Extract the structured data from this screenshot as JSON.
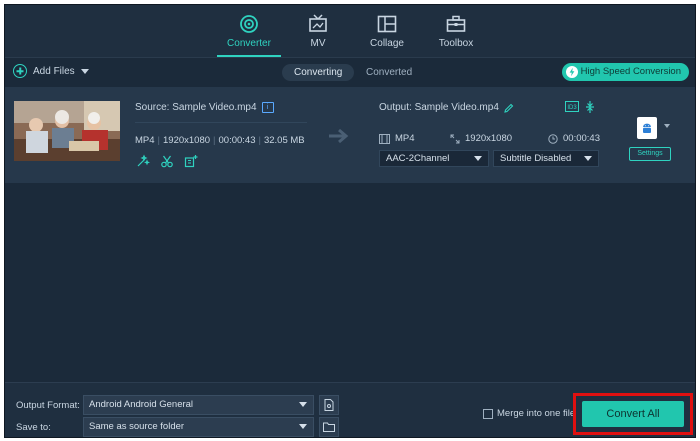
{
  "nav": {
    "tabs": [
      {
        "label": "Converter",
        "icon": "converter-icon",
        "active": true
      },
      {
        "label": "MV",
        "icon": "tv-icon",
        "active": false
      },
      {
        "label": "Collage",
        "icon": "collage-icon",
        "active": false
      },
      {
        "label": "Toolbox",
        "icon": "toolbox-icon",
        "active": false
      }
    ]
  },
  "toolbar": {
    "add_files": "Add Files",
    "seg_converting": "Converting",
    "seg_converted": "Converted",
    "high_speed": "High Speed Conversion"
  },
  "file": {
    "source": "Source: Sample Video.mp4",
    "format": "MP4",
    "resolution": "1920x1080",
    "duration": "00:00:43",
    "size": "32.05 MB",
    "output": "Output: Sample Video.mp4",
    "out_format": "MP4",
    "out_resolution": "1920x1080",
    "out_duration": "00:00:43",
    "audio": "AAC-2Channel",
    "subtitle": "Subtitle Disabled",
    "settings_label": "Settings"
  },
  "bottom": {
    "output_format_label": "Output Format:",
    "output_format_value": "Android Android General",
    "save_to_label": "Save to:",
    "save_to_value": "Same as source folder",
    "merge_label": "Merge into one file",
    "convert_all": "Convert All"
  },
  "colors": {
    "accent": "#2fd3c0",
    "button": "#21c6ae",
    "highlight_border": "#e01010",
    "background": "#1b2a3a"
  }
}
